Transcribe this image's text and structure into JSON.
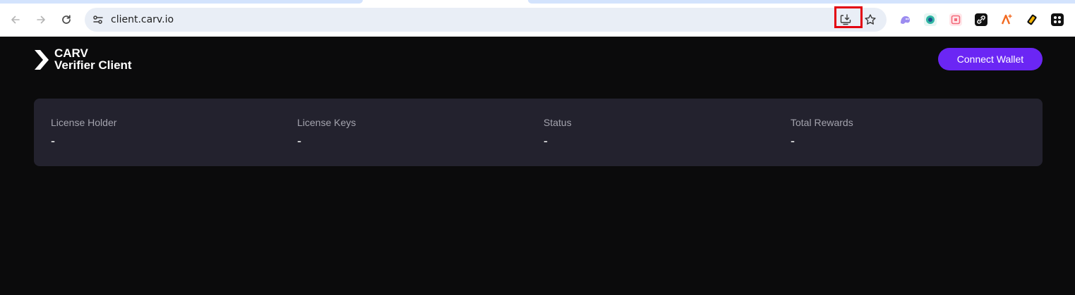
{
  "browser": {
    "url": "client.carv.io",
    "icons": {
      "back": "arrow-left-icon",
      "forward": "arrow-right-icon",
      "reload": "reload-icon",
      "site_info": "tune-icon",
      "install": "install-app-icon",
      "bookmark": "star-icon"
    },
    "extensions": [
      {
        "name": "ghost-extension-icon",
        "color": "#9c8cf0"
      },
      {
        "name": "globe-extension-icon",
        "color": "#2fb6a3"
      },
      {
        "name": "qr-extension-icon",
        "color": "#f36a7a"
      },
      {
        "name": "link-extension-icon",
        "color": "#111111"
      },
      {
        "name": "sparkle-extension-icon",
        "color": "#f26a21"
      },
      {
        "name": "coin-extension-icon",
        "color": "#f5b300"
      },
      {
        "name": "grid-extension-icon",
        "color": "#111111"
      }
    ],
    "highlight_color": "#e3000f"
  },
  "app": {
    "logo_line1": "CARV",
    "logo_line2": "Verifier Client",
    "connect_button": "Connect Wallet",
    "accent_color": "#6b26f4"
  },
  "stats": [
    {
      "label": "License Holder",
      "value": "-"
    },
    {
      "label": "License Keys",
      "value": "-"
    },
    {
      "label": "Status",
      "value": "-"
    },
    {
      "label": "Total Rewards",
      "value": "-"
    }
  ]
}
